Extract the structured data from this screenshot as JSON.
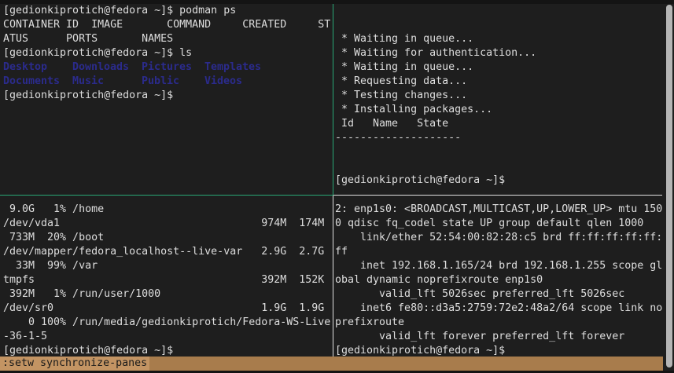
{
  "panes": {
    "top_left": {
      "lines": [
        "[gedionkiprotich@fedora ~]$ podman ps",
        "CONTAINER ID  IMAGE       COMMAND     CREATED     ST",
        "ATUS      PORTS       NAMES"
      ],
      "ls_prompt": "[gedionkiprotich@fedora ~]$ ls",
      "ls_rows": [
        [
          "Desktop",
          "Downloads",
          "Pictures",
          "Templates"
        ],
        [
          "Documents",
          "Music",
          "Public",
          "Videos"
        ]
      ],
      "final_prompt": "[gedionkiprotich@fedora ~]$"
    },
    "top_right": {
      "lines": [
        "",
        "",
        " * Waiting in queue...",
        " * Waiting for authentication...",
        " * Waiting in queue...",
        " * Requesting data...",
        " * Testing changes...",
        " * Installing packages...",
        " Id   Name   State",
        "--------------------",
        "",
        "",
        "[gedionkiprotich@fedora ~]$"
      ]
    },
    "bottom_left": {
      "lines": [
        " 9.0G   1% /home",
        "/dev/vda1                                974M  174M",
        " 733M  20% /boot",
        "/dev/mapper/fedora_localhost--live-var   2.9G  2.7G",
        "  33M  99% /var",
        "tmpfs                                    392M  152K",
        " 392M   1% /run/user/1000",
        "/dev/sr0                                 1.9G  1.9G",
        "    0 100% /run/media/gedionkiprotich/Fedora-WS-Live",
        "-36-1-5",
        "[gedionkiprotich@fedora ~]$"
      ]
    },
    "bottom_right": {
      "lines": [
        "2: enp1s0: <BROADCAST,MULTICAST,UP,LOWER_UP> mtu 150",
        "0 qdisc fq_codel state UP group default qlen 1000",
        "    link/ether 52:54:00:82:28:c5 brd ff:ff:ff:ff:ff:",
        "ff",
        "    inet 192.168.1.165/24 brd 192.168.1.255 scope gl",
        "obal dynamic noprefixroute enp1s0",
        "       valid_lft 5026sec preferred_lft 5026sec",
        "    inet6 fe80::d3a5:2759:72e2:48a2/64 scope link no",
        "prefixroute",
        "       valid_lft forever preferred_lft forever",
        "[gedionkiprotich@fedora ~]$"
      ]
    }
  },
  "status_bar": {
    "command": ":setw synchronize-panes"
  },
  "colors": {
    "background": "#1e1e1e",
    "active_border": "#2aa876",
    "status_bar": "#a87c4c",
    "directory": "#2b2b8c"
  }
}
